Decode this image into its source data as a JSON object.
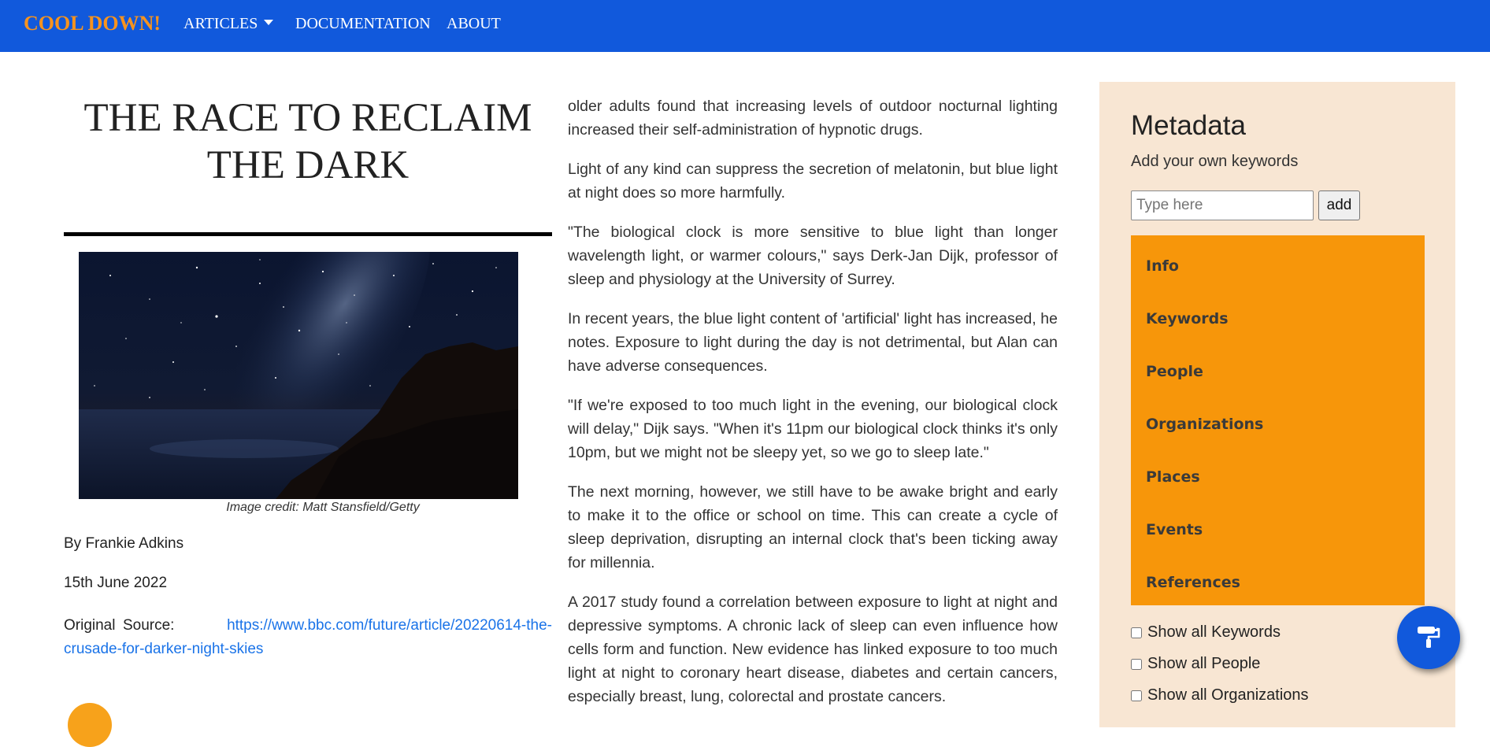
{
  "nav": {
    "brand": "COOL DOWN!",
    "articles": "ARTICLES",
    "documentation": "DOCUMENTATION",
    "about": "ABOUT"
  },
  "article": {
    "title": "THE RACE TO RECLAIM THE DARK",
    "image_credit": "Image credit: Matt Stansfield/Getty",
    "byline": "By Frankie Adkins",
    "date": "15th June 2022",
    "source_label": "Original Source:",
    "source_url": "https://www.bbc.com/future/article/20220614-the-crusade-for-darker-night-skies",
    "paragraphs": [
      "older adults found that increasing levels of outdoor nocturnal lighting increased their self-administration of hypnotic drugs.",
      "Light of any kind can suppress the secretion of melatonin, but blue light at night does so more harmfully.",
      "\"The biological clock is more sensitive to blue light than longer wavelength light, or warmer colours,\" says Derk-Jan Dijk, professor of sleep and physiology at the University of Surrey.",
      "In recent years, the blue light content of 'artificial' light has increased, he notes. Exposure to light during the day is not detrimental, but Alan can have adverse consequences.",
      "\"If we're exposed to too much light in the evening, our biological clock will delay,\" Dijk says. \"When it's 11pm our biological clock thinks it's only 10pm, but we might not be sleepy yet, so we go to sleep late.\"",
      "The next morning, however, we still have to be awake bright and early to make it to the office or school on time. This can create a cycle of sleep deprivation, disrupting an internal clock that's been ticking away for millennia.",
      "A 2017 study found a correlation between exposure to light at night and depressive symptoms. A chronic lack of sleep can even influence how cells form and function. New evidence has linked exposure to too much light at night to coronary heart disease, diabetes and certain cancers, especially breast, lung, colorectal and prostate cancers."
    ]
  },
  "sidebar": {
    "title": "Metadata",
    "subtitle": "Add your own keywords",
    "input_placeholder": "Type here",
    "add_label": "add",
    "facets": [
      "Info",
      "Keywords",
      "People",
      "Organizations",
      "Places",
      "Events",
      "References"
    ],
    "checks": [
      "Show all Keywords",
      "Show all People",
      "Show all Organizations"
    ]
  },
  "colors": {
    "navbar": "#1159dc",
    "brand": "#f7931e",
    "sidebar_bg": "#f8e6d3",
    "facet_bg": "#f7960a",
    "link": "#1a73e8"
  },
  "icons": {
    "fab": "paint-roller-icon",
    "dropdown": "caret-down-icon"
  }
}
